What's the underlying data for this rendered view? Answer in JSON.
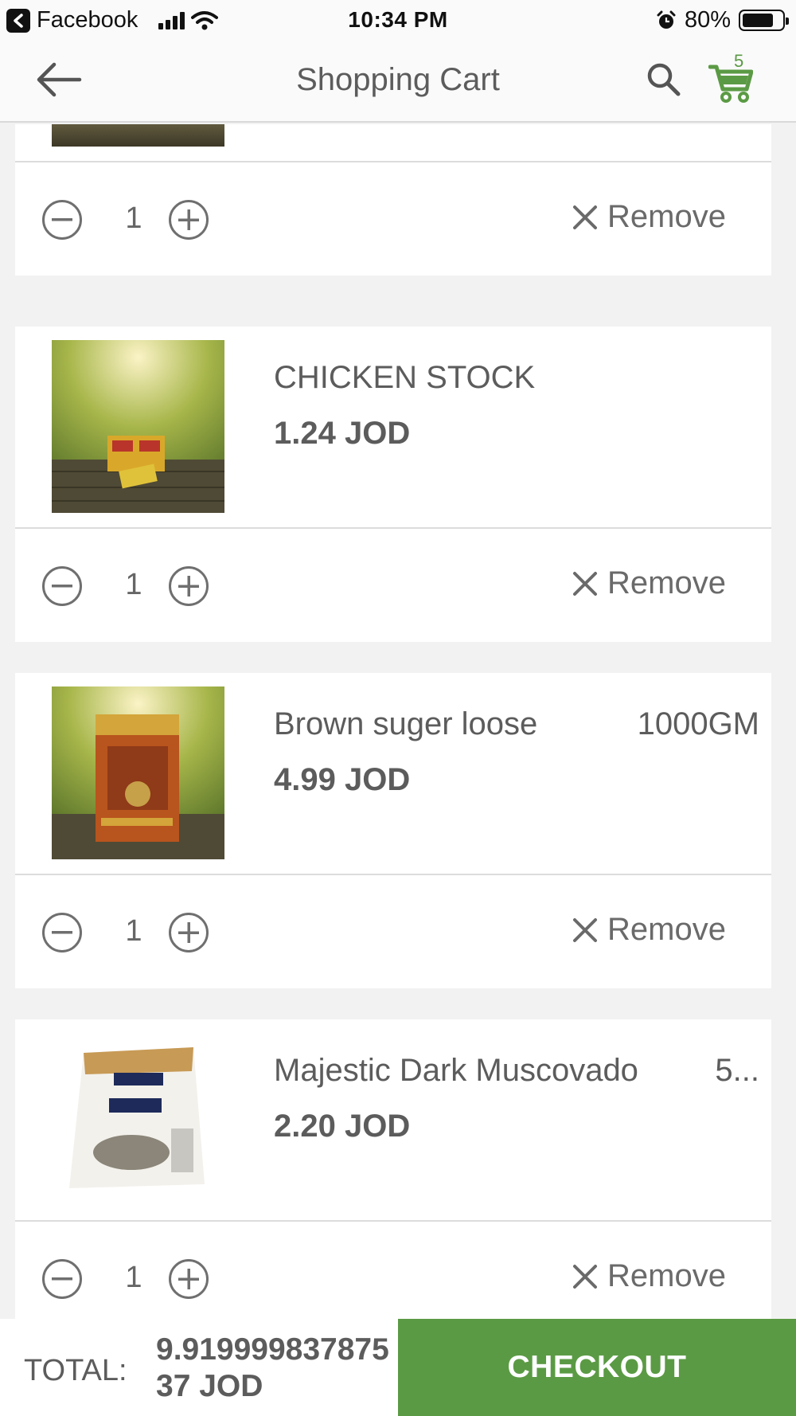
{
  "status_bar": {
    "app": "Facebook",
    "time": "10:34 PM",
    "battery": "80%",
    "battery_level": 0.8
  },
  "header": {
    "title": "Shopping Cart",
    "cart_count": "5"
  },
  "colors": {
    "accent": "#5b9a44",
    "text": "#5c5c5c",
    "divider": "#dcdcdc"
  },
  "partial_item": {
    "quantity": "1",
    "remove_label": "Remove"
  },
  "items": [
    {
      "name": "CHICKEN STOCK",
      "size": "",
      "price": "1.24 JOD",
      "quantity": "1",
      "remove_label": "Remove"
    },
    {
      "name": "Brown suger loose",
      "size": "1000GM",
      "price": "4.99 JOD",
      "quantity": "1",
      "remove_label": "Remove"
    },
    {
      "name": "Majestic Dark Muscovado",
      "size": "5...",
      "price": "2.20 JOD",
      "quantity": "1",
      "remove_label": "Remove"
    }
  ],
  "footer": {
    "total_label": "TOTAL:",
    "total_value": "9.91999983787537 JOD",
    "checkout_label": "CHECKOUT"
  }
}
